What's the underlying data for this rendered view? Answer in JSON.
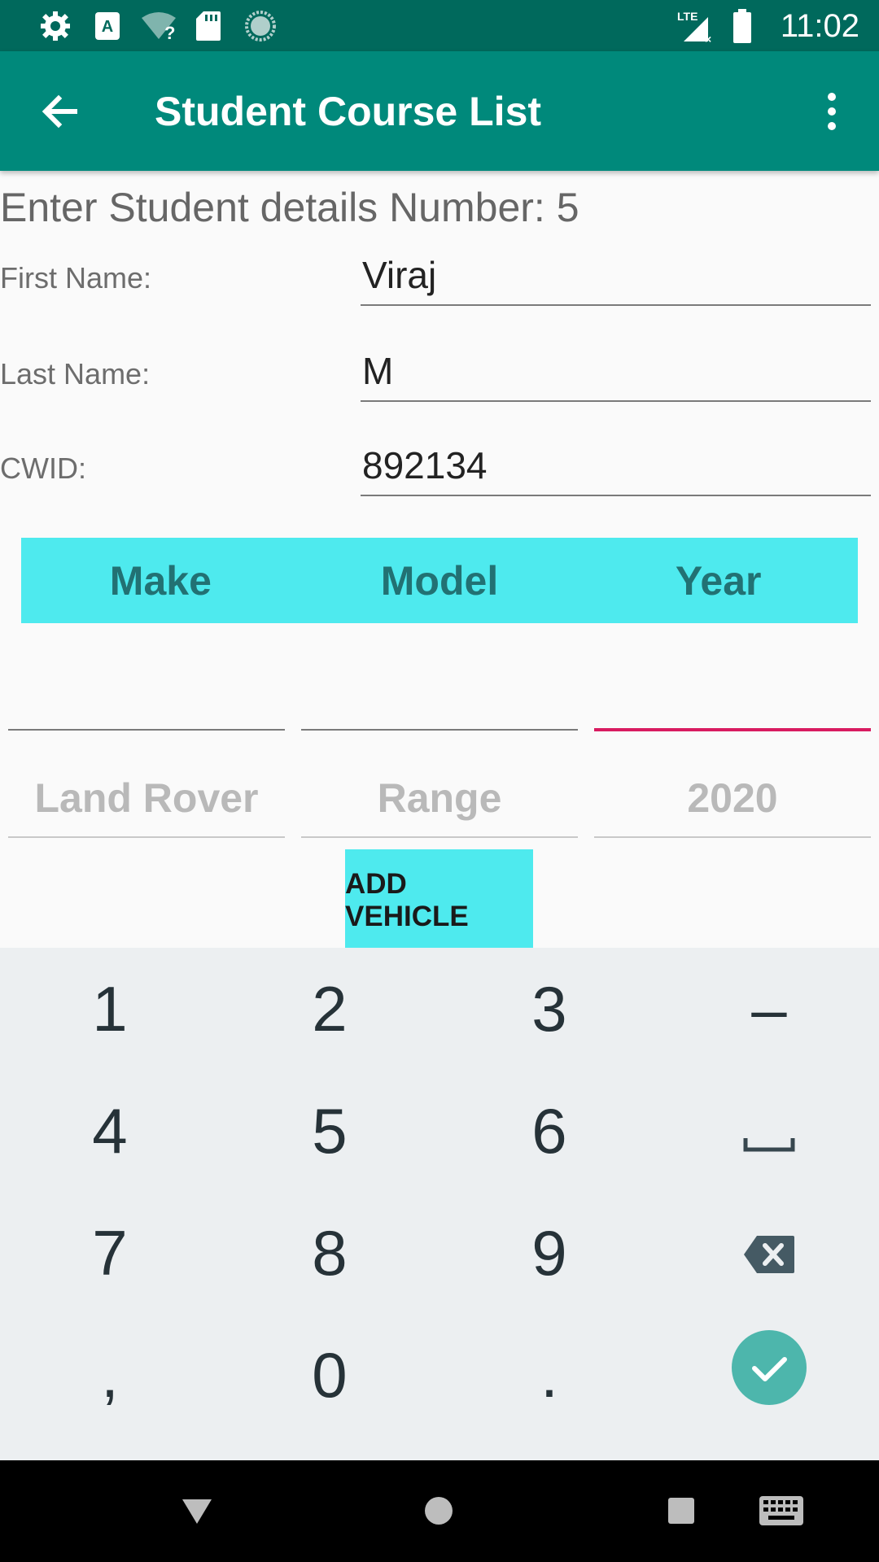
{
  "status_bar": {
    "time": "11:02",
    "icons": [
      "settings-icon",
      "a-badge-icon",
      "wifi-question-icon",
      "sd-card-icon",
      "sync-circle-icon",
      "lte-signal-icon",
      "battery-icon"
    ]
  },
  "app_bar": {
    "title": "Student Course List",
    "back_icon": "arrow-back-icon",
    "menu_icon": "more-vert-icon"
  },
  "form": {
    "heading": "Enter Student details Number: 5",
    "first_name_label": "First Name:",
    "first_name_value": "Viraj",
    "last_name_label": "Last Name:",
    "last_name_value": "M",
    "cwid_label": "CWID:",
    "cwid_value": "892134"
  },
  "vehicle_table": {
    "headers": [
      "Make",
      "Model",
      "Year"
    ],
    "hints": [
      "Land Rover",
      "Range",
      "2020"
    ],
    "add_button": "ADD VEHICLE"
  },
  "keyboard": {
    "keys": [
      "1",
      "2",
      "3",
      "–",
      "4",
      "5",
      "6",
      "␣",
      "7",
      "8",
      "9",
      "⌫",
      ",",
      "0",
      ".",
      "✓"
    ],
    "accent_color": "#4db6ac"
  },
  "colors": {
    "app_bar": "#00897b",
    "status_bar": "#00695c",
    "table_header": "#4eeaee",
    "focus_line": "#d81b60"
  }
}
